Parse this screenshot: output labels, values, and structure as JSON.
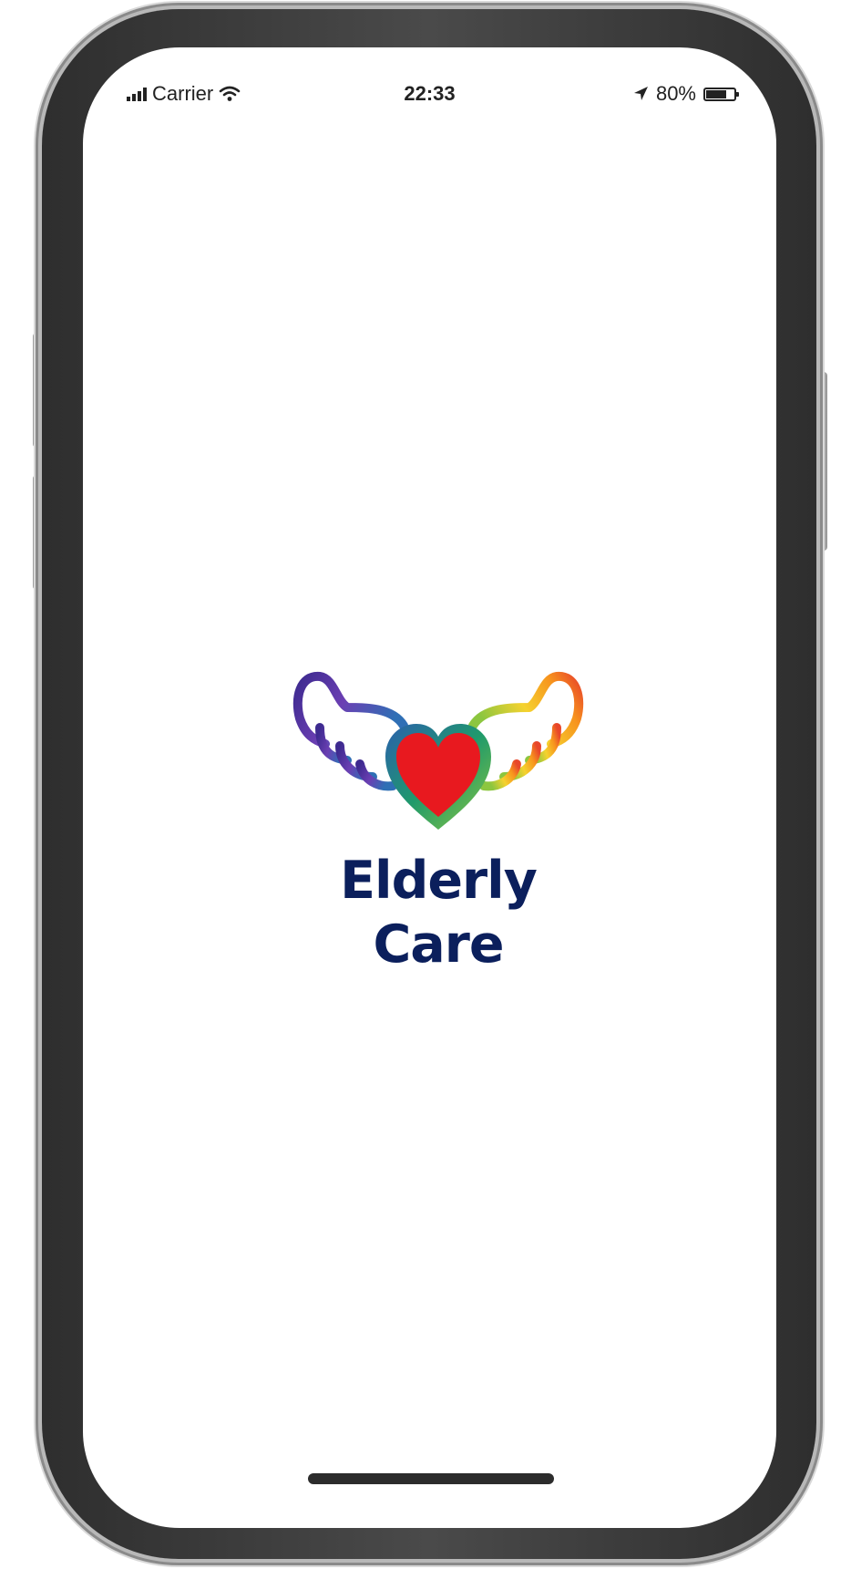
{
  "status_bar": {
    "carrier": "Carrier",
    "time": "22:33",
    "battery_percent": "80%",
    "battery_level": 0.8,
    "icons": {
      "signal": "cellular-signal-icon",
      "wifi": "wifi-icon",
      "location": "location-arrow-icon",
      "battery": "battery-icon"
    }
  },
  "splash": {
    "app_name": "Elderly Care",
    "logo": "winged-heart-logo"
  },
  "colors": {
    "brand_text": "#0b1f5c",
    "heart_fill": "#e8191f",
    "frame": "#3c3c3c",
    "screen_bg": "#ffffff"
  }
}
